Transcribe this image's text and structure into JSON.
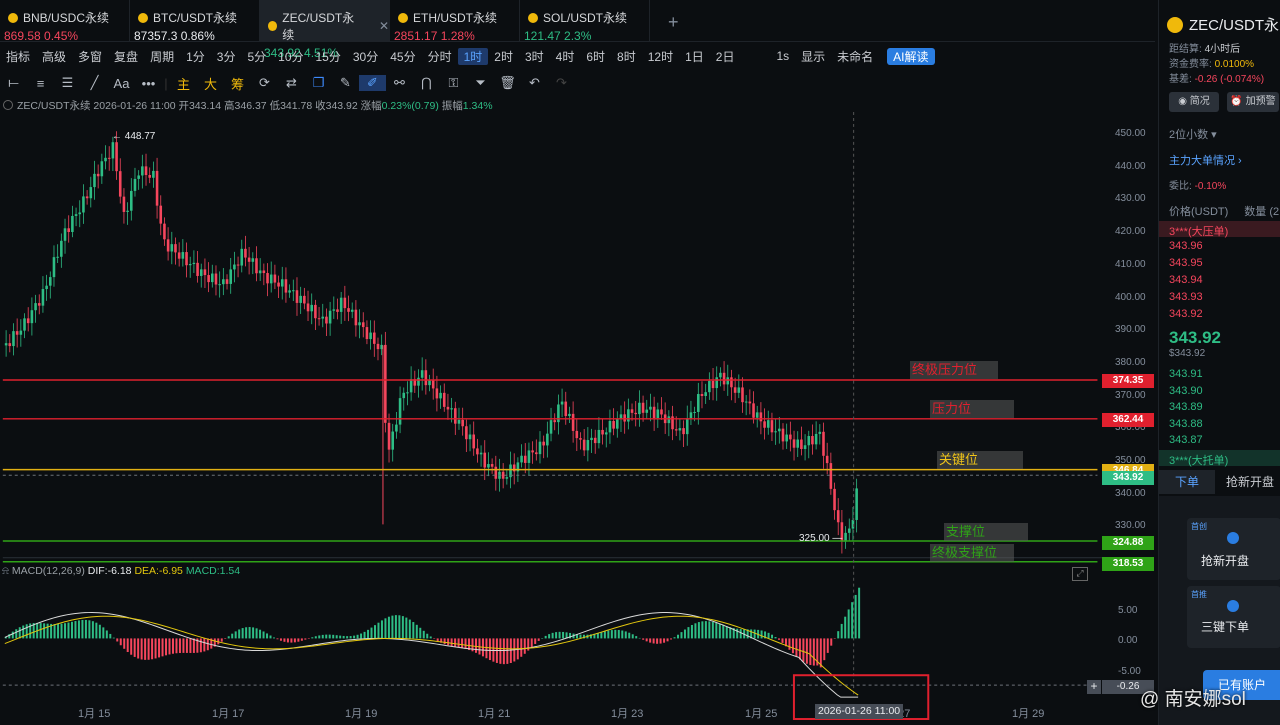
{
  "tabs": [
    {
      "name": "BNB/USDC永续",
      "price": "869.58",
      "change": "0.45%",
      "color": "red"
    },
    {
      "name": "BTC/USDT永续",
      "price": "87357.3",
      "change": "0.86%",
      "color": "white"
    },
    {
      "name": "ZEC/USDT永续",
      "price": "343.92",
      "change": "4.51%",
      "color": "green",
      "active": true
    },
    {
      "name": "ETH/USDT永续",
      "price": "2851.17",
      "change": "1.28%",
      "color": "red"
    },
    {
      "name": "SOL/USDT永续",
      "price": "121.47",
      "change": "2.3%",
      "color": "green"
    }
  ],
  "add_tab": "+",
  "toolbar1": [
    "指标",
    "高级",
    "多窗",
    "复盘",
    "周期",
    "1分",
    "3分",
    "5分",
    "10分",
    "15分",
    "30分",
    "45分",
    "分时",
    "1时",
    "2时",
    "3时",
    "4时",
    "6时",
    "8时",
    "12时",
    "1日",
    "2日",
    "1s",
    "显示",
    "未命名",
    "AI解读"
  ],
  "toolbar1_active": "1时",
  "toolbar2_labels": {
    "aa": "Aa",
    "zhu": "主",
    "da": "大",
    "chou": "筹"
  },
  "info": {
    "symbol": "ZEC/USDT永续",
    "time": "2026-01-26 11:00",
    "open_l": "开",
    "open": "343.14",
    "high_l": "高",
    "high": "346.37",
    "low_l": "低",
    "low": "341.78",
    "close_l": "收",
    "close": "343.92",
    "chg_l": "涨幅",
    "chg": "0.23%(0.79)",
    "amp_l": "振幅",
    "amp": "1.34%"
  },
  "yaxis": [
    "450.00",
    "440.00",
    "430.00",
    "420.00",
    "410.00",
    "400.00",
    "390.00",
    "380.00",
    "370.00",
    "360.00",
    "350.00",
    "340.00",
    "330.00"
  ],
  "macd_yaxis": [
    "5.00",
    "0.00",
    "-5.00"
  ],
  "xaxis": [
    "1月 15",
    "1月 17",
    "1月 19",
    "1月 21",
    "1月 23",
    "1月 25",
    "1月 27",
    "1月 29"
  ],
  "crosshair_date": "2026-01-26 11:00",
  "high_marker": "448.77",
  "low_marker": "325.00",
  "levels": [
    {
      "label": "终极压力位",
      "value": "374.35",
      "color": "#e0202e",
      "text_color": "#e0202e"
    },
    {
      "label": "压力位",
      "value": "362.44",
      "color": "#e0202e",
      "text_color": "#e0202e"
    },
    {
      "label": "关键位",
      "value": "346.84",
      "color": "#e2b013",
      "text_color": "#f0c419"
    },
    {
      "label": "支撑位",
      "value": "324.88",
      "color": "#2fa317",
      "text_color": "#2fa317"
    },
    {
      "label": "终极支撑位",
      "value": "318.53",
      "color": "#2fa317",
      "text_color": "#2fa317"
    }
  ],
  "current_price_tag": "343.92",
  "macd": {
    "title": "MACD(12,26,9)",
    "dif": "DIF:-6.18",
    "dea": "DEA:-6.95",
    "macd": "MACD:1.54",
    "tag": "-0.26"
  },
  "right": {
    "symbol": "ZEC/USDT永",
    "settle_l": "距结算:",
    "settle": "4小时后",
    "fund_l": "资金费率:",
    "fund": "0.0100%",
    "basis_l": "基差:",
    "basis": "-0.26 (-0.074%)",
    "btn1": "简况",
    "btn2": "加预警",
    "decimals": "2位小数",
    "big_orders": "主力大单情况",
    "ratio_l": "委比:",
    "ratio": "-0.10%",
    "col_price": "价格(USDT)",
    "col_qty": "数量 (2",
    "ask_big": "3***(大压单)",
    "asks": [
      "343.96",
      "343.95",
      "343.94",
      "343.93",
      "343.92"
    ],
    "last": "343.92",
    "last_sub": "$343.92",
    "bids": [
      "343.91",
      "343.90",
      "343.89",
      "343.88",
      "343.87"
    ],
    "bid_big": "3***(大托单)",
    "tab_order": "下单",
    "tab_quick": "抢新开盘",
    "card1_tag": "首创",
    "card1_label": "抢新开盘",
    "card2_tag": "首推",
    "card2_label": "三键下单",
    "account_btn": "已有账户"
  },
  "watermark": "南安娜sol"
}
